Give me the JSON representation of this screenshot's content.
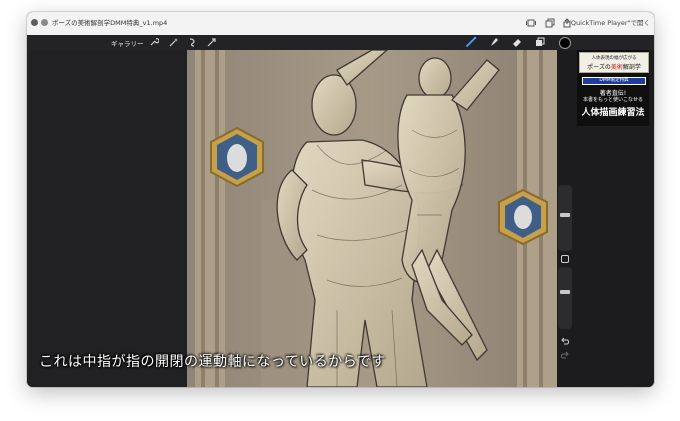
{
  "window": {
    "title": "ポーズの美術解剖学DMM特典_v1.mp4",
    "open_with": "\"QuickTime Player\"で開く",
    "icons": [
      "close-icon",
      "minimize-icon",
      "display-icon",
      "copy-icon",
      "share-icon"
    ]
  },
  "toolbar": {
    "gallery_label": "ギャラリー",
    "left_tools": [
      "wrench-icon",
      "magic-wand-icon",
      "selection-icon",
      "transform-icon"
    ],
    "right_tools": [
      "brush-icon",
      "smudge-icon",
      "eraser-icon",
      "layers-icon"
    ],
    "active_tool": "brush-icon",
    "current_color": "#000000"
  },
  "book": {
    "kicker": "人体表現の幅が広がる",
    "name_pre": "ポーズの",
    "name_red": "美術",
    "name_post": "解剖学",
    "tag": "DMM限定特典",
    "line1": "著者直伝!",
    "line2": "本書をもっと使いこなせる",
    "title": "人体描画練習法"
  },
  "sidebar": {
    "brush_size": 0.55,
    "opacity": 0.6,
    "icons": [
      "modify-square-icon",
      "undo-icon",
      "redo-icon"
    ]
  },
  "caption": {
    "text": "これは中指が指の開閉の運動軸になっているからです"
  },
  "colors": {
    "app_bg": "#1b1b1d",
    "accent": "#4aa0ff",
    "book_red": "#c02020",
    "book_blue": "#1f3e9a"
  }
}
